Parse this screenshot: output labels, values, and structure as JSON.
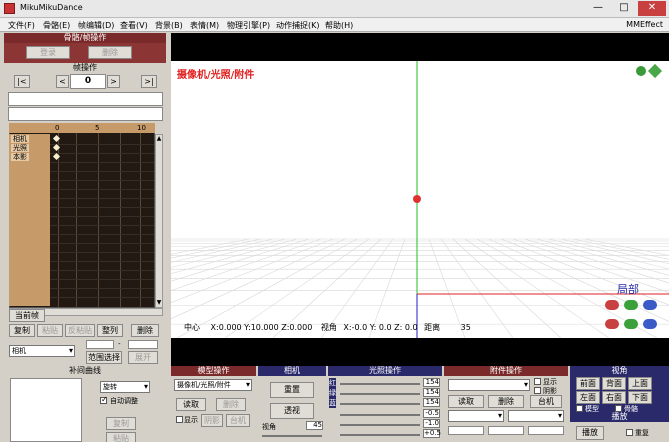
{
  "window": {
    "title": "MikuMikuDance",
    "controls": [
      "minimize-icon",
      "maximize-icon",
      "close-icon"
    ]
  },
  "menu": {
    "items": [
      "文件(F)",
      "骨骼(E)",
      "帧编辑(D)",
      "查看(V)",
      "背景(B)",
      "表情(M)",
      "物理引擎(P)",
      "动作捕捉(K)",
      "帮助(H)"
    ],
    "right_label": "MMEffect"
  },
  "bone_panel": {
    "header": "骨骼/帧操作",
    "register_label": "登录",
    "delete_label": "删除"
  },
  "frame_ops": {
    "header": "帧操作",
    "first": "|<",
    "prev": "<",
    "frame_value": "0",
    "next": ">",
    "last": ">|"
  },
  "timeline": {
    "ruler_marks": [
      "0",
      "5",
      "10"
    ],
    "rows": [
      "相机",
      "光照",
      "本影"
    ]
  },
  "left_bottom": {
    "current_frame": "当前帧",
    "copy": "复制",
    "paste": "粘贴",
    "reverse_paste": "反粘贴",
    "align": "整列",
    "delete": "删除",
    "camera_select": "相机",
    "range_select": "范围选择",
    "expand": "展开"
  },
  "curve_panel": {
    "header": "补间曲线",
    "rotate_select": "旋转",
    "auto_adjust": "自动调整",
    "auto_adjust_checked": true,
    "copy": "复制",
    "paste": "粘贴"
  },
  "viewport": {
    "mode_label": "摄像机/光照/附件",
    "local_label": "局部",
    "info_center": "中心",
    "info_x": "X:0.000",
    "info_y": "Y:10.000",
    "info_z": "Z:0.000",
    "info_view": "视角",
    "info_vx": "X:-0.0",
    "info_vy": "Y: 0.0",
    "info_vz": "Z: 0.0",
    "info_dist_label": "距离",
    "info_dist": "35"
  },
  "model_panel": {
    "header": "模型操作",
    "model_select": "摄像机/光照/附件",
    "load": "读取",
    "delete": "删除",
    "display": "显示",
    "shadow": "阴影",
    "accessory": "台机"
  },
  "camera_panel": {
    "header": "相机",
    "reset": "重置",
    "perspective": "透视",
    "fov_label": "视角",
    "fov_value": "45"
  },
  "light_panel": {
    "header": "光照操作",
    "labels": [
      "红",
      "绿",
      "蓝"
    ],
    "values": [
      "154",
      "154",
      "154"
    ],
    "xyz": [
      "-0.5",
      "-1.0",
      "+0.5"
    ]
  },
  "accessory_panel": {
    "header": "附件操作",
    "display": "显示",
    "shadow": "阴影",
    "load": "读取",
    "delete": "删除",
    "table": "台机"
  },
  "view_panel": {
    "header": "视角",
    "front": "前面",
    "back": "背面",
    "top": "上面",
    "left": "左面",
    "right": "右面",
    "bottom": "下面",
    "model": "模型",
    "bone": "骨骼"
  },
  "play_panel": {
    "header": "播放",
    "play": "播放",
    "loop": "重复"
  },
  "colors": {
    "dark_red": "#7a2a2a",
    "navy": "#2a2a6a",
    "grid_bg": "#221a12",
    "axis_red": "#e02020",
    "axis_green": "#20c020",
    "axis_blue": "#2020c0"
  }
}
